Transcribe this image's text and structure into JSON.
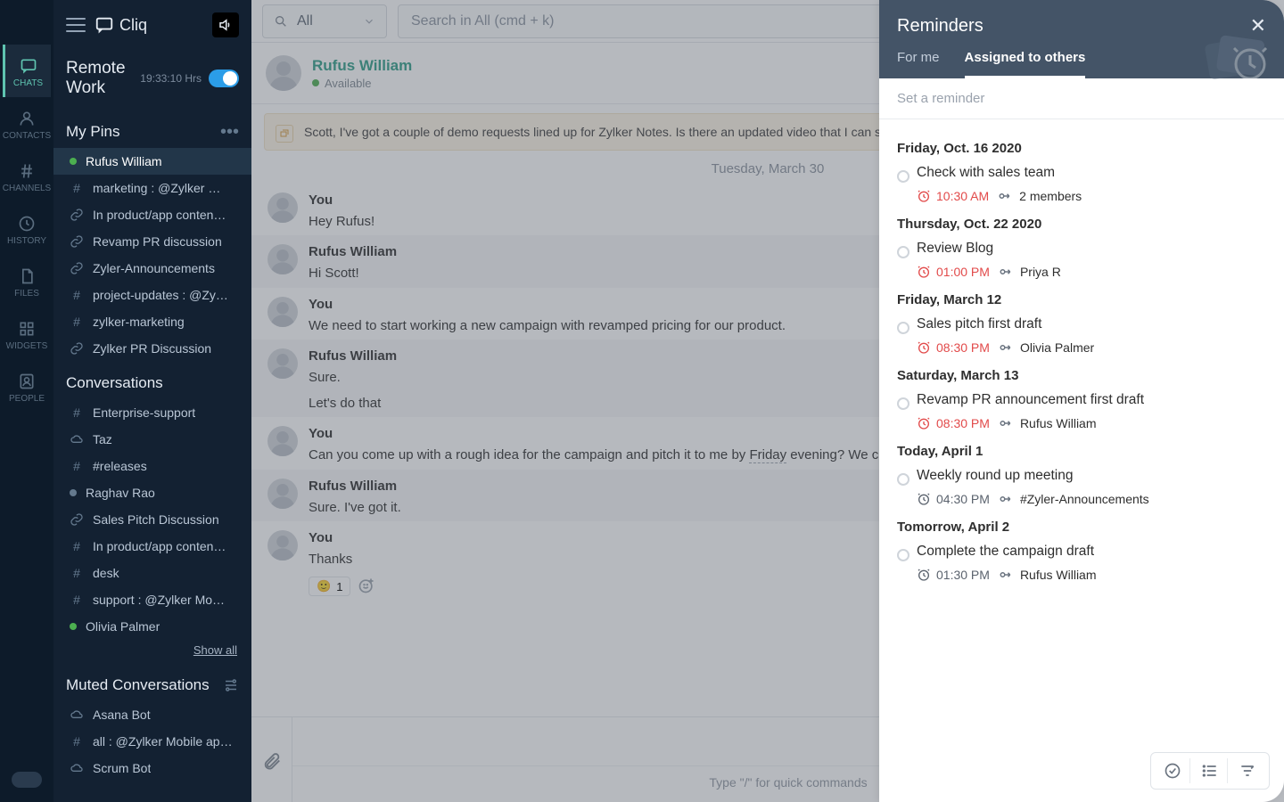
{
  "brand": "Cliq",
  "rail": [
    {
      "label": "CHATS",
      "icon": "chat"
    },
    {
      "label": "CONTACTS",
      "icon": "contact"
    },
    {
      "label": "CHANNELS",
      "icon": "hash"
    },
    {
      "label": "HISTORY",
      "icon": "history"
    },
    {
      "label": "FILES",
      "icon": "file"
    },
    {
      "label": "WIDGETS",
      "icon": "widgets"
    },
    {
      "label": "PEOPLE",
      "icon": "people"
    }
  ],
  "remote": {
    "title": "Remote Work",
    "time": "19:33:10 Hrs"
  },
  "pins_title": "My Pins",
  "pins": [
    {
      "icon": "presence",
      "label": "Rufus William",
      "active": true
    },
    {
      "icon": "hash",
      "label": "marketing : @Zylker …"
    },
    {
      "icon": "link",
      "label": "In product/app conten…"
    },
    {
      "icon": "link",
      "label": "Revamp PR discussion"
    },
    {
      "icon": "link",
      "label": "Zyler-Announcements"
    },
    {
      "icon": "hash",
      "label": "project-updates : @Zy…"
    },
    {
      "icon": "hash",
      "label": "zylker-marketing"
    },
    {
      "icon": "link",
      "label": "Zylker PR Discussion"
    }
  ],
  "conv_title": "Conversations",
  "conversations": [
    {
      "icon": "hash",
      "label": "Enterprise-support"
    },
    {
      "icon": "cloud",
      "label": "Taz"
    },
    {
      "icon": "hash",
      "label": "#releases"
    },
    {
      "icon": "dot",
      "label": "Raghav Rao"
    },
    {
      "icon": "link",
      "label": "Sales Pitch Discussion"
    },
    {
      "icon": "hash",
      "label": "In product/app conten…"
    },
    {
      "icon": "hash",
      "label": "desk"
    },
    {
      "icon": "hash",
      "label": "support : @Zylker Mo…"
    },
    {
      "icon": "presence",
      "label": "Olivia Palmer"
    }
  ],
  "show_all": "Show all",
  "muted_title": "Muted Conversations",
  "muted": [
    {
      "icon": "cloud",
      "label": "Asana Bot"
    },
    {
      "icon": "hash",
      "label": "all : @Zylker Mobile ap…"
    },
    {
      "icon": "cloud",
      "label": "Scrum Bot"
    }
  ],
  "scope": {
    "label": "All"
  },
  "search": {
    "placeholder": "Search in All (cmd + k)"
  },
  "chat": {
    "name": "Rufus William",
    "status": "Available",
    "banner": "Scott, I've got a couple of demo requests lined up for Zylker Notes. Is there an updated video that I can share with",
    "date_divider": "Tuesday, March 30",
    "messages": [
      {
        "author": "You",
        "lines": [
          "Hey Rufus!"
        ],
        "alt": false
      },
      {
        "author": "Rufus William",
        "lines": [
          "Hi Scott!"
        ],
        "alt": true
      },
      {
        "author": "You",
        "lines": [
          "We need to start working a new campaign with revamped pricing for our product."
        ],
        "alt": false
      },
      {
        "author": "Rufus William",
        "lines": [
          "Sure.",
          "Let's do that"
        ],
        "alt": true
      },
      {
        "author": "You",
        "lines": [
          "Can you come up with a rough idea for the campaign and pitch it to me by  <u>Friday</u>  evening? We c"
        ],
        "alt": false
      },
      {
        "author": "Rufus William",
        "lines": [
          "Sure. I've got it."
        ],
        "alt": true
      },
      {
        "author": "You",
        "lines": [
          "Thanks"
        ],
        "alt": false,
        "reaction": {
          "emoji": "🙂",
          "count": 1
        }
      }
    ],
    "compose_hint": "Type \"/\" for quick commands"
  },
  "reminders": {
    "title": "Reminders",
    "tabs": [
      "For me",
      "Assigned to others"
    ],
    "active_tab": 1,
    "input_placeholder": "Set a reminder",
    "groups": [
      {
        "date": "Friday, Oct. 16 2020",
        "items": [
          {
            "title": "Check with sales team",
            "time": "10:30 AM",
            "time_red": true,
            "assignee": "2 members"
          }
        ]
      },
      {
        "date": "Thursday, Oct. 22 2020",
        "items": [
          {
            "title": "Review Blog",
            "time": "01:00 PM",
            "time_red": true,
            "assignee": "Priya R"
          }
        ]
      },
      {
        "date": "Friday, March 12",
        "items": [
          {
            "title": "Sales pitch first draft",
            "time": "08:30 PM",
            "time_red": true,
            "assignee": "Olivia Palmer"
          }
        ]
      },
      {
        "date": "Saturday, March 13",
        "items": [
          {
            "title": "Revamp PR announcement first draft",
            "time": "08:30 PM",
            "time_red": true,
            "assignee": "Rufus William"
          }
        ]
      },
      {
        "date": "Today, April 1",
        "items": [
          {
            "title": "Weekly round up meeting",
            "time": "04:30 PM",
            "time_red": false,
            "assignee": "#Zyler-Announcements"
          }
        ]
      },
      {
        "date": "Tomorrow, April 2",
        "items": [
          {
            "title": "Complete the campaign draft",
            "time": "01:30 PM",
            "time_red": false,
            "assignee": "Rufus William"
          }
        ]
      }
    ]
  }
}
